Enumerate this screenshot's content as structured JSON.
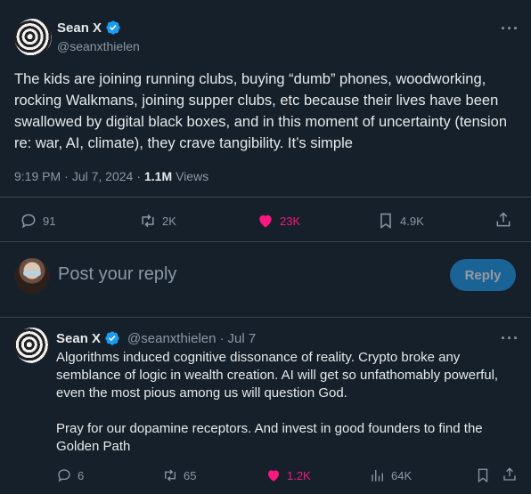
{
  "main_tweet": {
    "author_name": "Sean X",
    "author_handle": "@seanxthielen",
    "text": "The kids are joining running clubs, buying “dumb” phones, woodworking, rocking Walkmans, joining supper clubs, etc because their lives have been swallowed by digital black boxes, and in this moment of uncertainty (tension re: war, AI, climate), they crave tangibility. It’s simple",
    "time": "9:19 PM",
    "date": "Jul 7, 2024",
    "views_count": "1.1M",
    "views_label": "Views",
    "replies": "91",
    "retweets": "2K",
    "likes": "23K",
    "bookmarks": "4.9K"
  },
  "reply_box": {
    "placeholder": "Post your reply",
    "button_label": "Reply"
  },
  "reply_tweet": {
    "author_name": "Sean X",
    "author_handle": "@seanxthielen",
    "date": "Jul 7",
    "paragraph1": "Algorithms induced cognitive dissonance of reality. Crypto broke any semblance of logic in wealth creation. AI will get so unfathomably powerful, even the most pious among us will question God.",
    "paragraph2": "Pray for our dopamine receptors. And invest in good founders to find the Golden Path",
    "replies": "6",
    "retweets": "65",
    "likes": "1.2K",
    "views": "64K"
  },
  "colors": {
    "background": "#15202b",
    "accent": "#1d9bf0",
    "like": "#f91880",
    "muted": "#8b98a5",
    "divider": "#38444d"
  },
  "icons": [
    "verified-badge-icon",
    "more-icon",
    "reply-icon",
    "retweet-icon",
    "heart-icon",
    "bookmark-icon",
    "share-icon",
    "views-icon"
  ]
}
